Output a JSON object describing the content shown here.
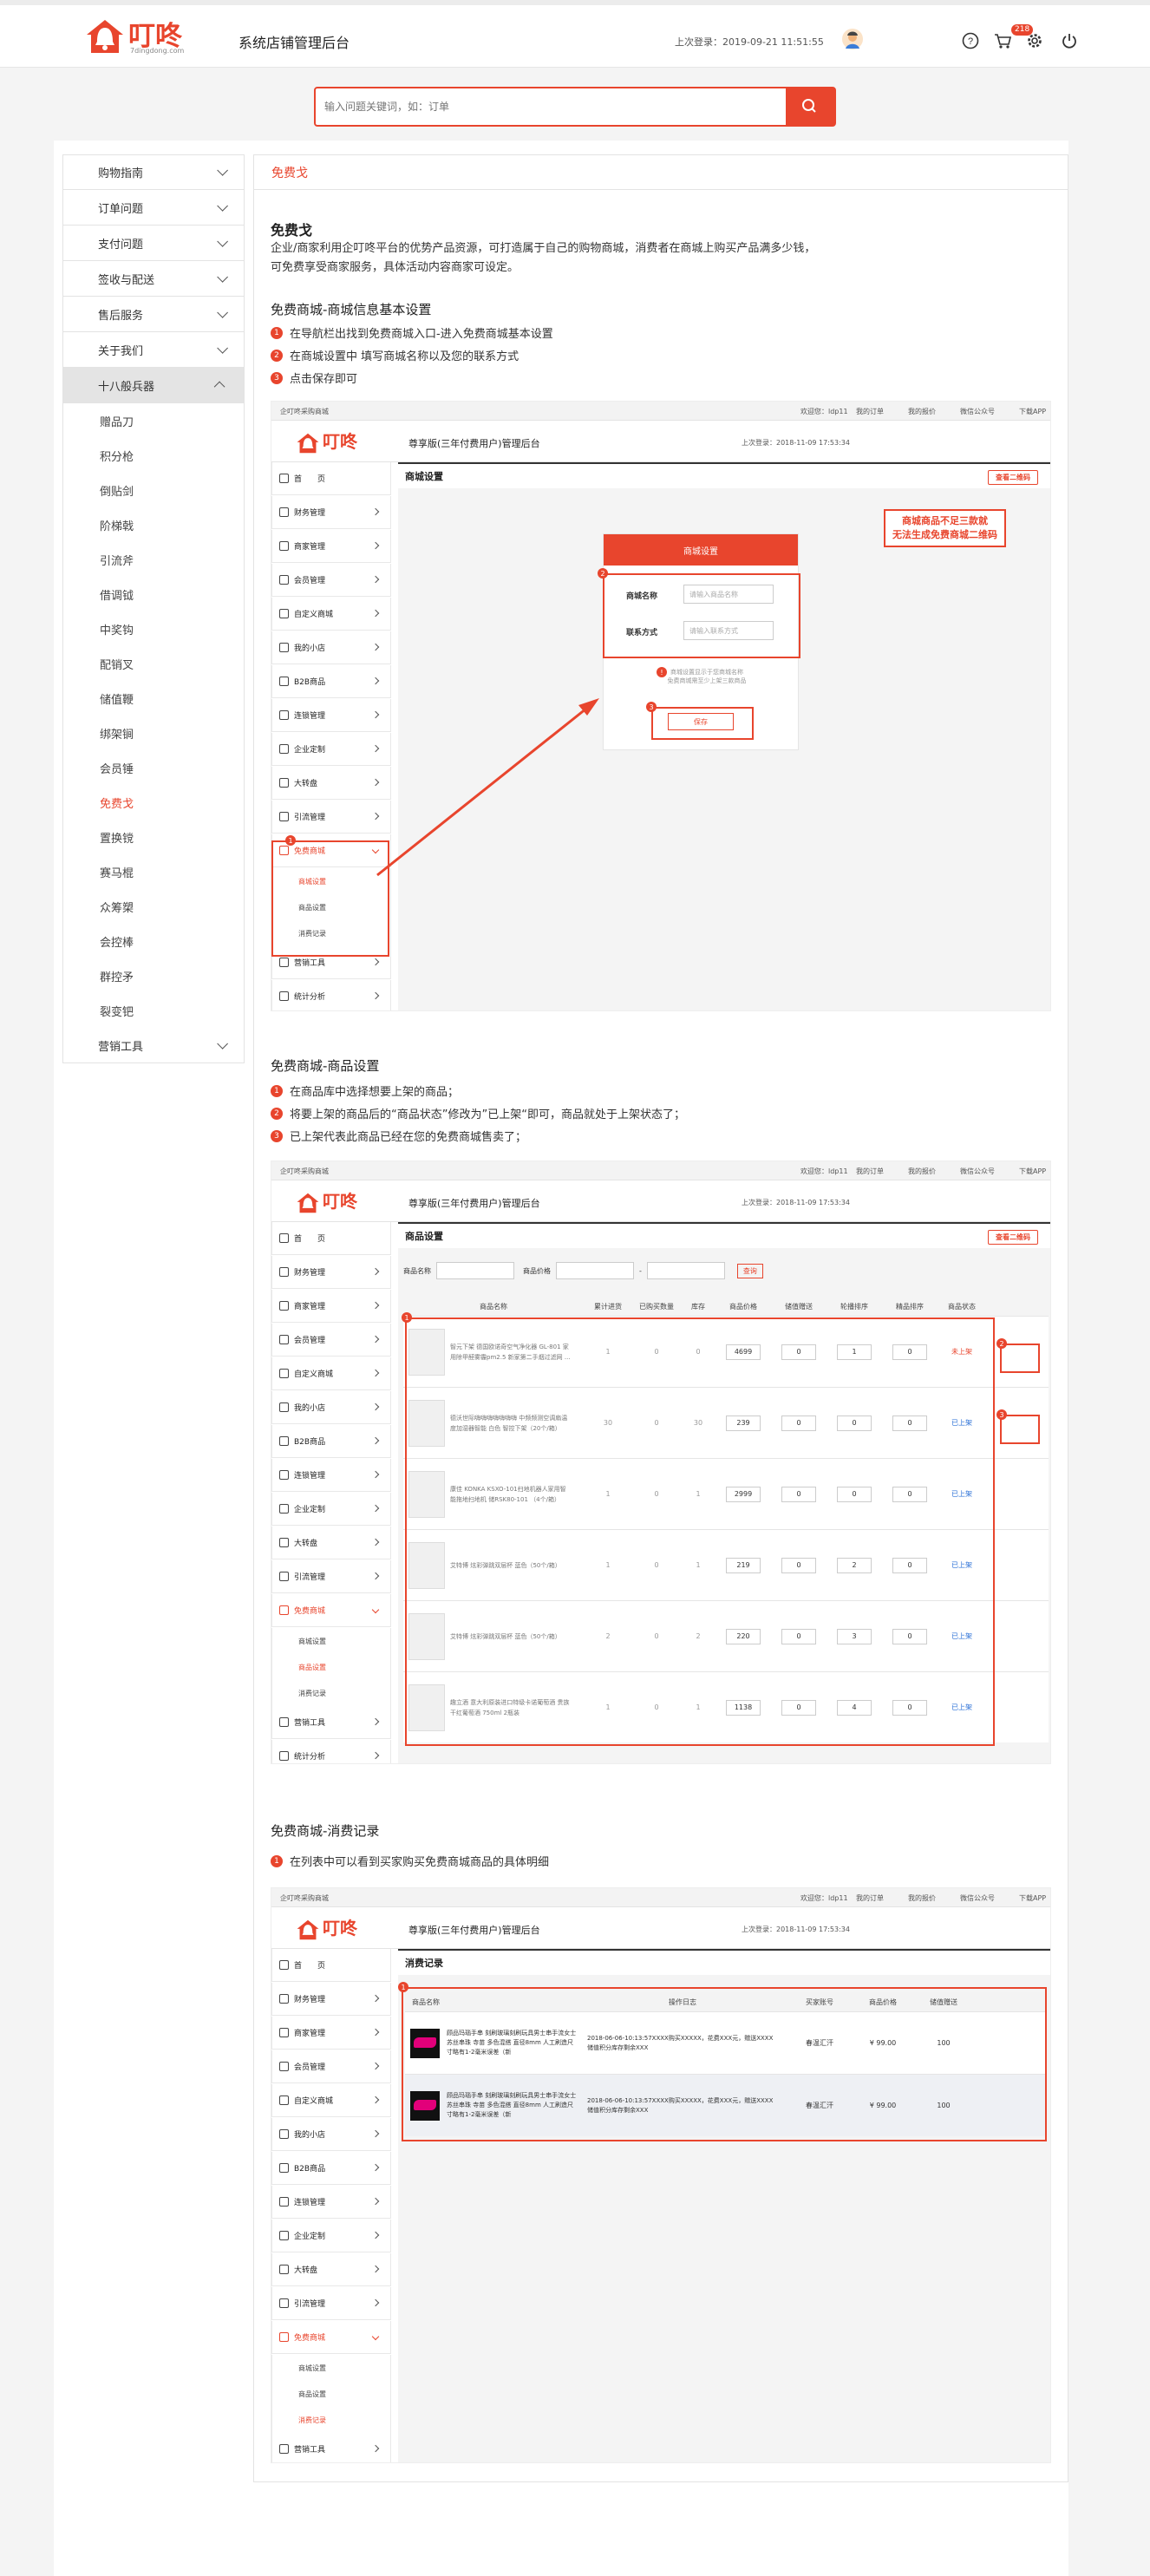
{
  "header": {
    "brand": "叮咚",
    "brand_sub": "7dingdong.com",
    "system_name": "系统店铺管理后台",
    "last_login": "上次登录：2019-09-21 11:51:55",
    "cart_badge": "218"
  },
  "search": {
    "placeholder": "输入问题关键词，如：订单"
  },
  "sidebar": {
    "items": [
      {
        "label": "购物指南"
      },
      {
        "label": "订单问题"
      },
      {
        "label": "支付问题"
      },
      {
        "label": "签收与配送"
      },
      {
        "label": "售后服务"
      },
      {
        "label": "关于我们"
      },
      {
        "label": "十八般兵器"
      }
    ],
    "subs": [
      "赠品刀",
      "积分枪",
      "倒贴剑",
      "阶梯戟",
      "引流斧",
      "借调钺",
      "中奖钩",
      "配销叉",
      "储值鞭",
      "绑架锏",
      "会员锤",
      "免费戈",
      "置换镋",
      "赛马棍",
      "众筹槊",
      "会控棒",
      "群控矛",
      "裂变钯"
    ],
    "last": {
      "label": "营销工具"
    }
  },
  "content": {
    "tab": "免费戈",
    "title": "免费戈",
    "intro1": "企业/商家利用企叮咚平台的优势产品资源，可打造属于自己的购物商城，消费者在商城上购买产品满多少钱，",
    "intro2": "可免费享受商家服务，具体活动内容商家可设定。",
    "sec1": "免费商城-商城信息基本设置",
    "sec1_steps": [
      "在导航栏出找到免费商城入口-进入免费商城基本设置",
      "在商城设置中 填写商城名称以及您的联系方式",
      "点击保存即可"
    ],
    "sec2": "免费商城-商品设置",
    "sec2_steps": [
      "在商品库中选择想要上架的商品；",
      "将要上架的商品后的“商品状态”修改为”已上架“即可，商品就处于上架状态了；",
      "已上架代表此商品已经在您的免费商城售卖了；"
    ],
    "sec3": "免费商城-消费记录",
    "sec3_steps": [
      "在列表中可以看到买家购买免费商城商品的具体明细"
    ]
  },
  "shot": {
    "topbar": {
      "left": "企叮咚采购商城",
      "user": "欢迎您：ldp11",
      "links": [
        "我的订单",
        "我的报价",
        "微信公众号",
        "下载APP"
      ]
    },
    "brand": "叮咚",
    "system": "尊享版(三年付费用户)管理后台",
    "last_login": "上次登录：2018-11-09 17:53:34",
    "user": "ldp11",
    "nav": [
      "首　　页",
      "财务管理",
      "商家管理",
      "会员管理",
      "自定义商城",
      "我的小店",
      "B2B商品",
      "连锁管理",
      "企业定制",
      "大转盘",
      "引流管理",
      "免费商城",
      "营销工具",
      "统计分析"
    ],
    "nav_subs": [
      "商城设置",
      "商品设置",
      "消费记录"
    ],
    "qr_button": "查看二维码"
  },
  "shot1": {
    "title": "商城设置",
    "card_title": "商城设置",
    "name_label": "商城名称",
    "name_placeholder": "请输入商品名称",
    "contact_label": "联系方式",
    "contact_placeholder": "请输入联系方式",
    "hint1": "商城设置显示于您商城名称",
    "hint2": "免费商城需至少上架三款商品",
    "save": "保存",
    "warn1": "商城商品不足三款就",
    "warn2": "无法生成免费商城二维码"
  },
  "shot2": {
    "title": "商品设置",
    "filter_name": "商品名称",
    "filter_price": "商品价格",
    "filter_dash": "-",
    "query": "查询",
    "columns": [
      "商品名称",
      "累计进货",
      "已购买数量",
      "库存",
      "商品价格",
      "储值赠送",
      "轮播排序",
      "精品排序",
      "商品状态"
    ],
    "rows": [
      {
        "name": "智元下架 德国欧诺奇空气净化器 GL-801 家用除甲醛雾霾pm2.5 新家第二手烟过滤网 ...",
        "in": "1",
        "sold": "0",
        "stock": "0",
        "price": "4699",
        "gift": "0",
        "sort": "1",
        "best": "0",
        "status": "未上架"
      },
      {
        "name": "德沃世际嗨嗨嗨嗨嗨嗨嗨 中频频测空调扇温度加湿器智能 白色 智控下架（20个/箱）",
        "in": "30",
        "sold": "0",
        "stock": "30",
        "price": "239",
        "gift": "0",
        "sort": "0",
        "best": "0",
        "status": "已上架"
      },
      {
        "name": "康佳 KONKA KSXO-101扫地机器人家用智能拖地扫地机 储RSK80-101 （4个/箱）",
        "in": "1",
        "sold": "0",
        "stock": "1",
        "price": "2999",
        "gift": "0",
        "sort": "0",
        "best": "0",
        "status": "已上架"
      },
      {
        "name": "艾特博 炫彩弹跳双层杯 蓝色（50个/箱）",
        "in": "1",
        "sold": "0",
        "stock": "1",
        "price": "219",
        "gift": "0",
        "sort": "2",
        "best": "0",
        "status": "已上架"
      },
      {
        "name": "艾特博 炫彩弹跳双层杯 蓝色（50个/箱）",
        "in": "2",
        "sold": "0",
        "stock": "2",
        "price": "220",
        "gift": "0",
        "sort": "3",
        "best": "0",
        "status": "已上架"
      },
      {
        "name": "趣立酒 意大利原装进口特级卡诺葡萄酒 贵族干红葡萄酒 750ml 2瓶装",
        "in": "1",
        "sold": "0",
        "stock": "1",
        "price": "1138",
        "gift": "0",
        "sort": "4",
        "best": "0",
        "status": "已上架"
      }
    ]
  },
  "shot3": {
    "title": "消费记录",
    "columns": [
      "商品名称",
      "操作日志",
      "买家账号",
      "商品价格",
      "储值赠送"
    ],
    "rows": [
      {
        "name": "顾品玛瑙手串 刻刷玻璃刻刷玩具男士串手流女士苏丝串珠 寺苗 多色混搭 直径8mm 人工刷造尺寸略有1-2毫米误差（新",
        "log": "2018-06-06-10:13:57XXXX购买XXXXX，花费XXX元，赠送XXXX储值积分库存剩余XXX",
        "buyer": "春温汇汗",
        "price": "¥ 99.00",
        "gift": "100"
      },
      {
        "name": "顾品玛瑙手串 刻刷玻璃刻刷玩具男士串手流女士苏丝串珠 寺苗 多色混搭 直径8mm 人工刷造尺寸略有1-2毫米误差（新",
        "log": "2018-06-06-10:13:57XXXX购买XXXXX，花费XXX元，赠送XXXX储值积分库存剩余XXX",
        "buyer": "春温汇汗",
        "price": "¥ 99.00",
        "gift": "100"
      }
    ]
  },
  "colors": {
    "accent": "#e8452d",
    "link": "#2a6fd6"
  }
}
